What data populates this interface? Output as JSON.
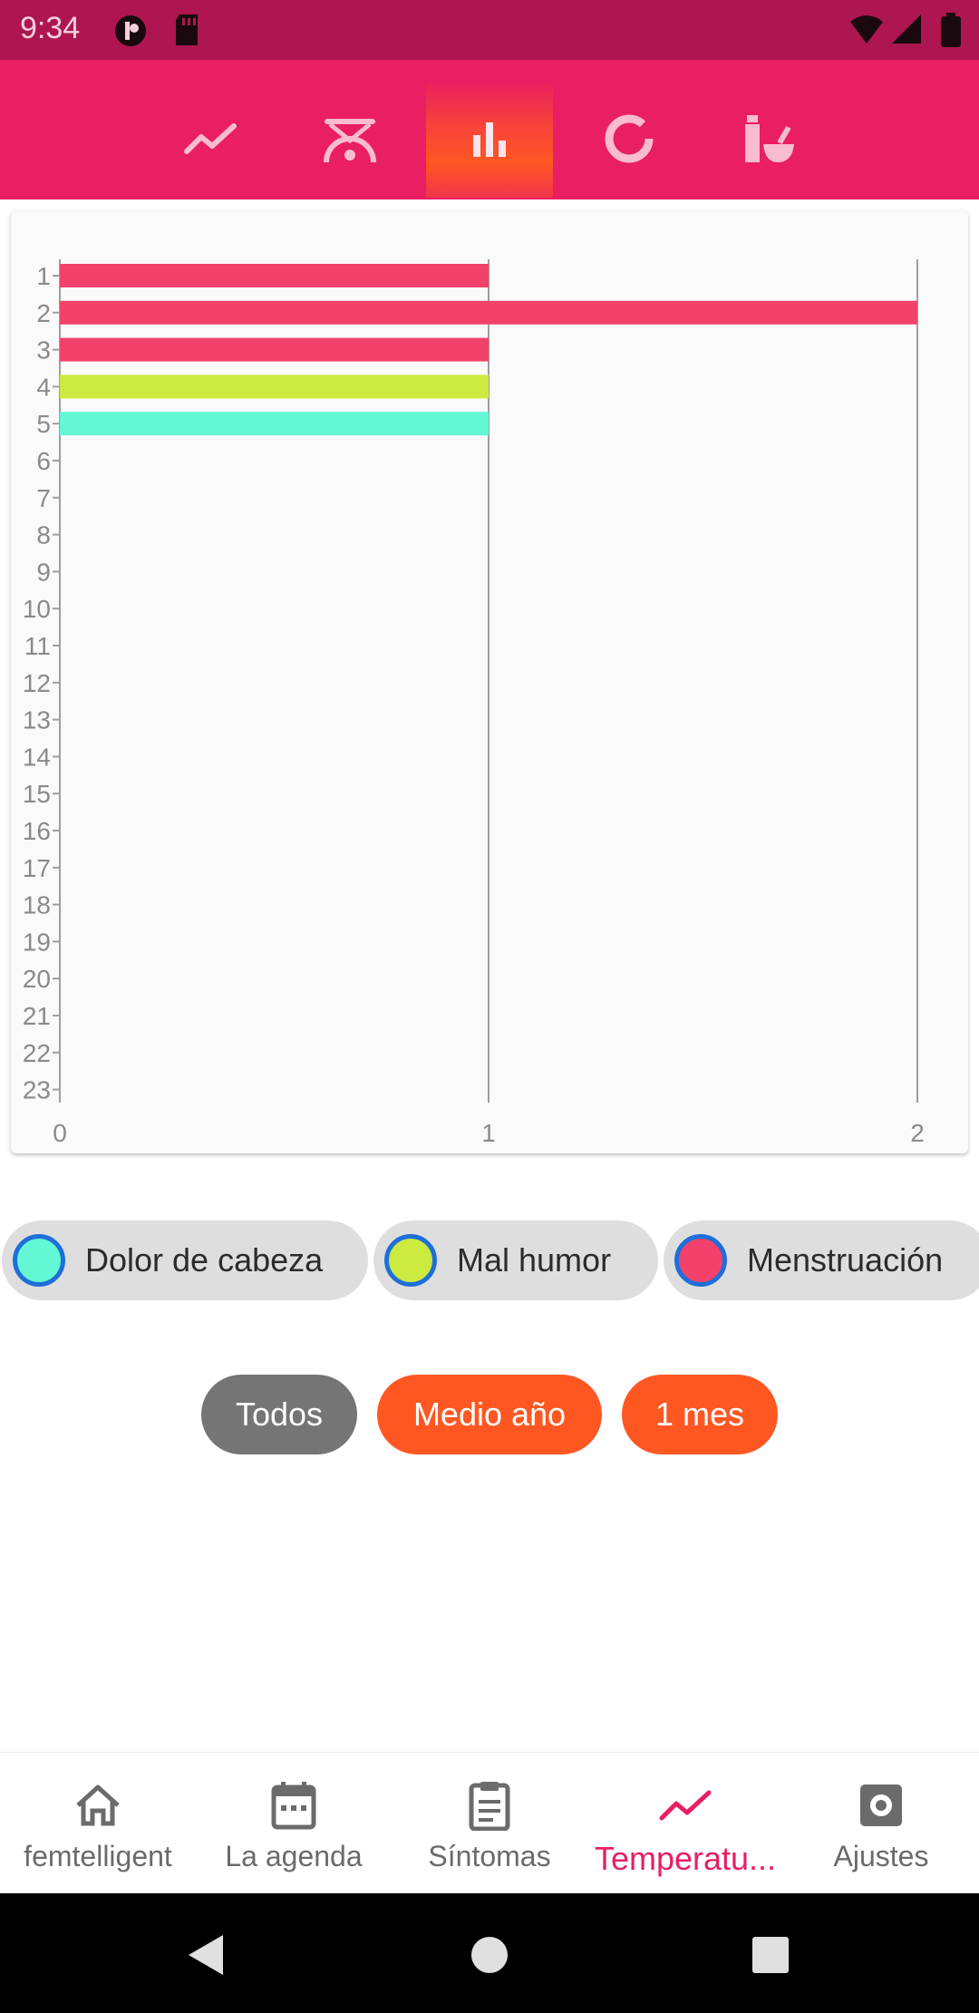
{
  "status_bar": {
    "time": "9:34",
    "icons": [
      "app-notification-icon",
      "sd-card-icon",
      "wifi-icon",
      "signal-icon",
      "battery-icon"
    ]
  },
  "top_tabs": [
    {
      "name": "line-chart-icon",
      "active": false
    },
    {
      "name": "gauge-icon",
      "active": false
    },
    {
      "name": "bar-chart-icon",
      "active": true
    },
    {
      "name": "donut-chart-icon",
      "active": false
    },
    {
      "name": "pills-icon",
      "active": false
    }
  ],
  "chart_data": {
    "type": "bar",
    "orientation": "horizontal",
    "categories": [
      "1",
      "2",
      "3",
      "4",
      "5",
      "6",
      "7",
      "8",
      "9",
      "10",
      "11",
      "12",
      "13",
      "14",
      "15",
      "16",
      "17",
      "18",
      "19",
      "20",
      "21",
      "22",
      "23"
    ],
    "values": [
      1,
      2,
      1,
      1,
      1,
      0,
      0,
      0,
      0,
      0,
      0,
      0,
      0,
      0,
      0,
      0,
      0,
      0,
      0,
      0,
      0,
      0,
      0
    ],
    "bar_colors": [
      "#f2426b",
      "#f2426b",
      "#f2426b",
      "#cdea40",
      "#64f7d4"
    ],
    "x_ticks": [
      "0",
      "1",
      "2"
    ],
    "xlim": [
      0,
      2
    ],
    "grid": "vertical"
  },
  "legend": [
    {
      "label": "Dolor de cabeza",
      "color": "#64f7d4"
    },
    {
      "label": "Mal humor",
      "color": "#cdea40"
    },
    {
      "label": "Menstruación",
      "color": "#f2426b"
    }
  ],
  "range_buttons": [
    {
      "label": "Todos",
      "color": "#757575"
    },
    {
      "label": "Medio año",
      "color": "#ff5722"
    },
    {
      "label": "1 mes",
      "color": "#ff5722"
    }
  ],
  "bottom_nav": [
    {
      "label": "femtelligent",
      "icon": "home-icon",
      "active": false
    },
    {
      "label": "La agenda",
      "icon": "calendar-icon",
      "active": false
    },
    {
      "label": "Síntomas",
      "icon": "clipboard-icon",
      "active": false
    },
    {
      "label": "Temperatu...",
      "icon": "trend-icon",
      "active": true
    },
    {
      "label": "Ajustes",
      "icon": "settings-icon",
      "active": false
    }
  ],
  "colors": {
    "status_bar": "#ad1650",
    "primary": "#e91e63",
    "accent": "#ff5722"
  }
}
